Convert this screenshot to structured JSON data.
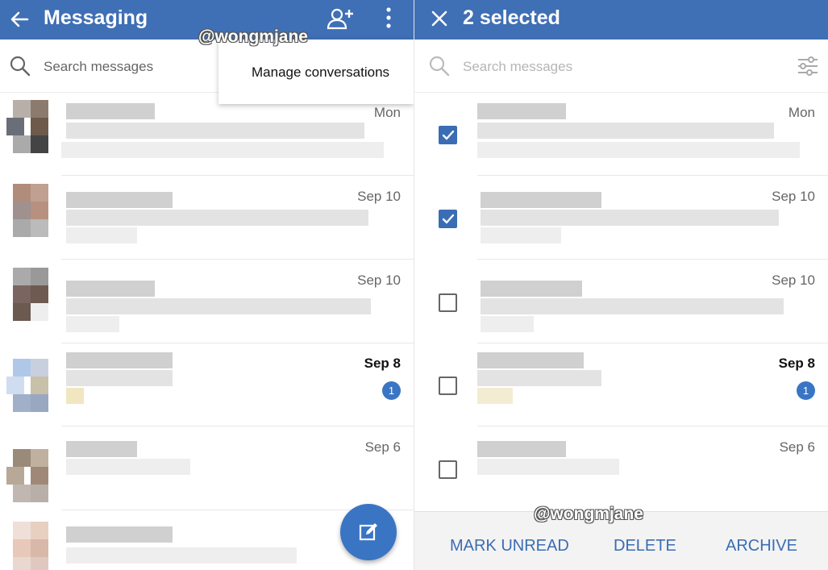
{
  "left": {
    "title": "Messaging",
    "search_placeholder": "Search messages",
    "menu": {
      "item": "Manage conversations"
    },
    "watermark": "@wongmjane",
    "rows": [
      {
        "date": "Mon",
        "bold": false,
        "badge": ""
      },
      {
        "date": "Sep 10",
        "bold": false,
        "badge": ""
      },
      {
        "date": "Sep 10",
        "bold": false,
        "badge": ""
      },
      {
        "date": "Sep 8",
        "bold": true,
        "badge": "1"
      },
      {
        "date": "Sep 6",
        "bold": false,
        "badge": ""
      },
      {
        "date": "",
        "bold": false,
        "badge": ""
      }
    ]
  },
  "right": {
    "title": "2 selected",
    "search_placeholder": "Search messages",
    "watermark": "@wongmjane",
    "rows": [
      {
        "date": "Mon",
        "bold": false,
        "badge": "",
        "checked": true
      },
      {
        "date": "Sep 10",
        "bold": false,
        "badge": "",
        "checked": true
      },
      {
        "date": "Sep 10",
        "bold": false,
        "badge": "",
        "checked": false
      },
      {
        "date": "Sep 8",
        "bold": true,
        "badge": "1",
        "checked": false
      },
      {
        "date": "Sep 6",
        "bold": false,
        "badge": "",
        "checked": false
      }
    ],
    "actions": {
      "mark_unread": "MARK UNREAD",
      "delete": "DELETE",
      "archive": "ARCHIVE"
    }
  },
  "icons": {
    "back": "arrow-left-icon",
    "add_person": "person-add-icon",
    "more": "more-vert-icon",
    "close": "close-icon",
    "search": "search-icon",
    "filter": "filter-sliders-icon",
    "compose": "edit-icon"
  },
  "colors": {
    "appbar": "#3f6fb5",
    "accent": "#3a75c4",
    "action_text": "#3a6db3"
  }
}
